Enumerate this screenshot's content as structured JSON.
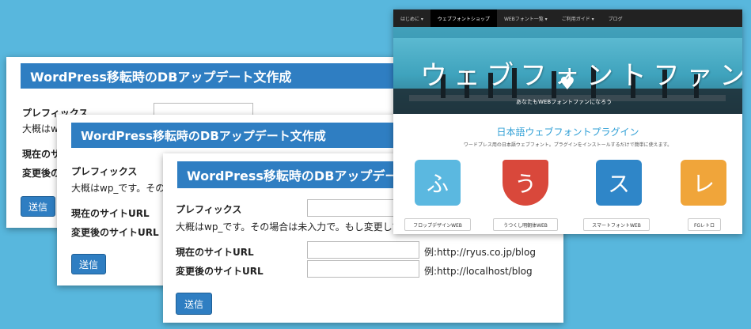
{
  "form": {
    "title": "WordPress移転時のDBアップデート文作成",
    "prefix_label": "プレフィックス",
    "prefix_note": "大概はwp_です。その場合は未入力で。もし変更して",
    "current_url_label": "現在のサイトURL",
    "new_url_label": "変更後のサイトURL",
    "current_url_example": "例:http://ryus.co.jp/blog",
    "new_url_example": "例:http://localhost/blog",
    "submit_label": "送信",
    "back_card_prefix_note": "大概はwp_",
    "back_card_current_label": "現在のサイ",
    "back_card_new_label": "変更後のサ",
    "mid_card_prefix_note": "大概はwp_です。その"
  },
  "site": {
    "nav": [
      "はじめに ▾",
      "ウェブフォントショップ",
      "WEBフォント一覧 ▾",
      "ご利用ガイド ▾",
      "ブログ"
    ],
    "hero_title": "ウェブフォントファン",
    "hero_subtitle": "あなたもWEBフォントファンになろう",
    "plugins_title": "日本語ウェブフォントプラグイン",
    "plugins_desc": "ワードプレス用の日本語ウェブフォント。プラグインをインストールするだけで簡単に使えます。",
    "tiles": [
      {
        "glyph": "ふ",
        "label": "フロップデザインWEB",
        "color": "#5bb8e0"
      },
      {
        "glyph": "う",
        "label": "うつくし明朝体WEB",
        "color": "#d9483b"
      },
      {
        "glyph": "ス",
        "label": "スマートフォントWEB",
        "color": "#2f86c8"
      },
      {
        "glyph": "レ",
        "label": "FGレトロ",
        "color": "#f0a53a"
      }
    ]
  }
}
